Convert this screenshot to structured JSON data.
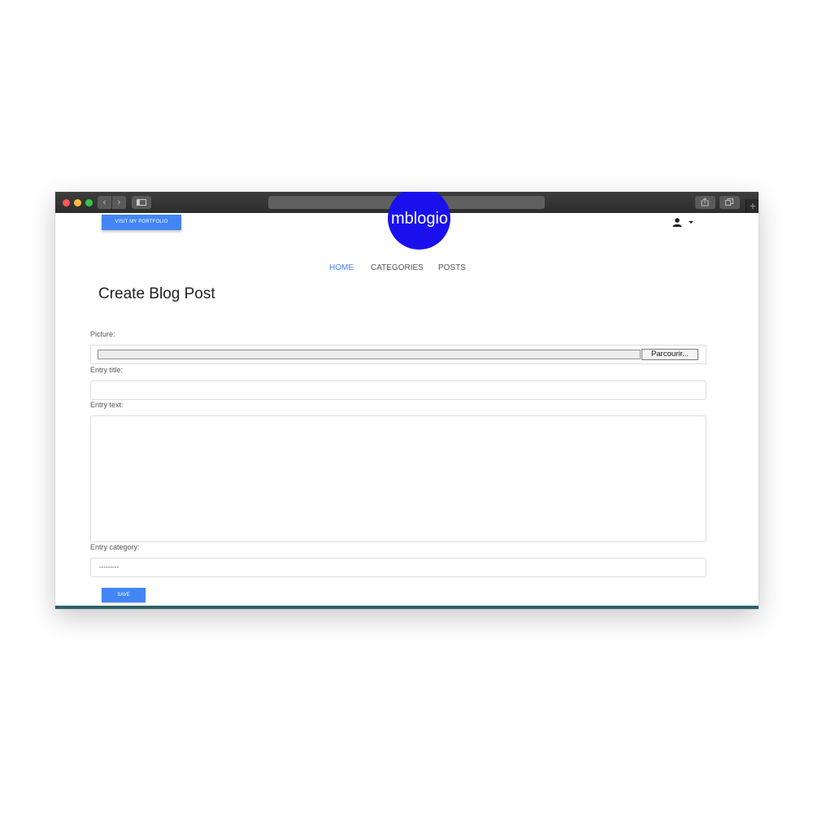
{
  "browser": {
    "url": "",
    "back_glyph": "‹",
    "forward_glyph": "›",
    "new_tab_glyph": "+"
  },
  "header": {
    "portfolio_button": "Visit my portfolio",
    "logo_text": "mblogio",
    "user_icon": "user-icon",
    "caret_icon": "caret-down-icon"
  },
  "menu": {
    "items": [
      {
        "label": "HOME",
        "active": true
      },
      {
        "label": "CATEGORIES",
        "active": false
      },
      {
        "label": "POSTS",
        "active": false
      }
    ]
  },
  "main": {
    "title": "Create Blog Post",
    "form": {
      "picture_label": "Picture:",
      "browse_label": "Parcourir...",
      "entry_title_label": "Entry title:",
      "entry_title_value": "",
      "entry_text_label": "Entry text:",
      "entry_text_value": "",
      "entry_category_label": "Entry category:",
      "entry_category_value": "---------",
      "save_label": "save"
    }
  },
  "colors": {
    "accent": "#4285f4",
    "logo": "#1a10ee",
    "footer_bar": "#2d5f66"
  }
}
